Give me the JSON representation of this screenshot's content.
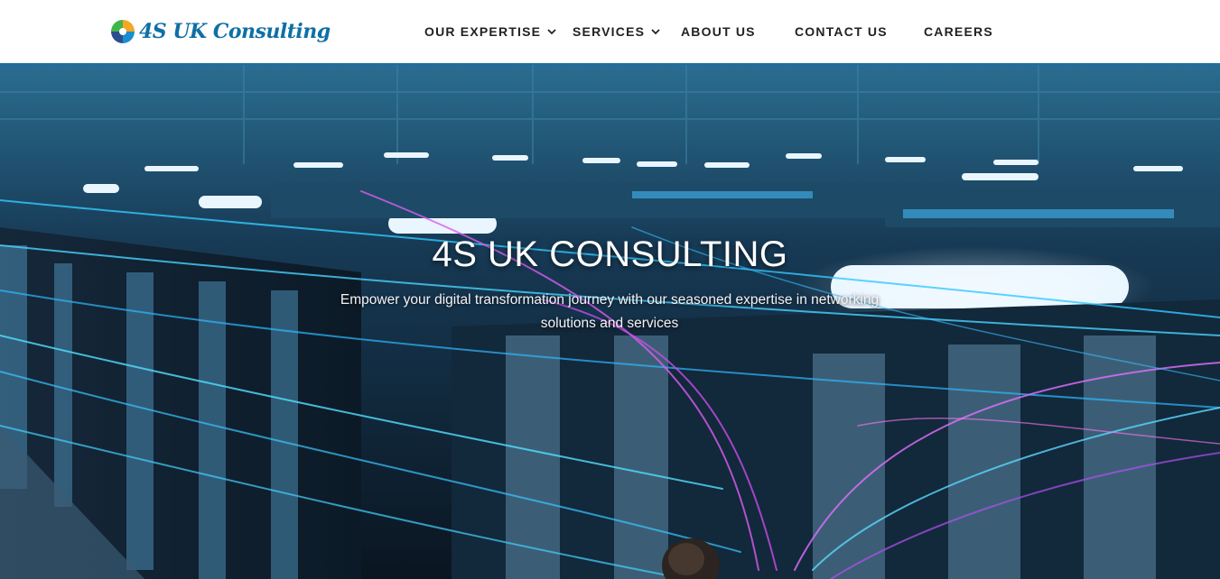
{
  "brand": {
    "name": "4S UK Consulting",
    "logo_icon": "swirl-logo-icon"
  },
  "nav": {
    "items": [
      {
        "label": "OUR EXPERTISE",
        "has_dropdown": true
      },
      {
        "label": "SERVICES",
        "has_dropdown": true
      },
      {
        "label": "ABOUT US",
        "has_dropdown": false
      },
      {
        "label": "CONTACT US",
        "has_dropdown": false
      },
      {
        "label": "CAREERS",
        "has_dropdown": false
      }
    ]
  },
  "hero": {
    "title": "4S UK CONSULTING",
    "subtitle": "Empower your digital transformation journey with our seasoned expertise in networking solutions and services"
  },
  "colors": {
    "brand_blue": "#0f6fa6",
    "header_border": "#1b6fa8",
    "nav_text": "#222222"
  }
}
